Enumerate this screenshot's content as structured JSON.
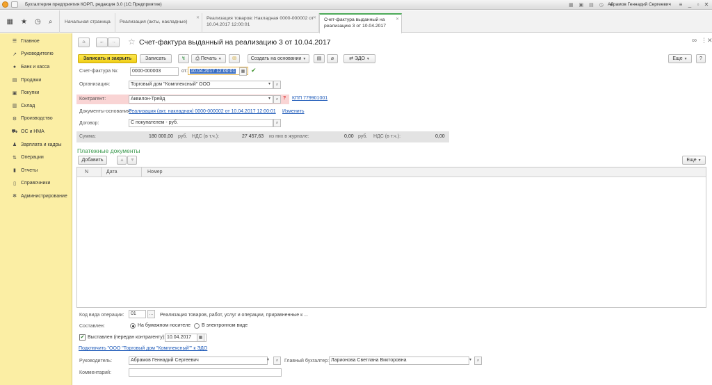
{
  "window": {
    "title": "Бухгалтерия предприятия КОРП, редакция 3.0  (1С:Предприятие)",
    "user": "Абрамов Геннадий Сергеевич",
    "icons": [
      "home-icon",
      "star-icon",
      "history-icon",
      "search-icon",
      "calc-icon",
      "calendar-icon",
      "print-icon",
      "bell-icon"
    ]
  },
  "tabs": [
    {
      "label": "Начальная страница"
    },
    {
      "label": "Реализация (акты, накладные)"
    },
    {
      "label": "Реализация товаров: Накладная 0000-000002 от 10.04.2017 12:00:01"
    },
    {
      "label": "Счет-фактура выданный на реализацию 3 от 10.04.2017"
    }
  ],
  "sidebar": {
    "items": [
      {
        "label": "Главное",
        "icon": "menu-icon"
      },
      {
        "label": "Руководителю",
        "icon": "trend-icon"
      },
      {
        "label": "Банк и касса",
        "icon": "bank-icon"
      },
      {
        "label": "Продажи",
        "icon": "sales-icon"
      },
      {
        "label": "Покупки",
        "icon": "cart-icon"
      },
      {
        "label": "Склад",
        "icon": "warehouse-icon"
      },
      {
        "label": "Производство",
        "icon": "factory-icon"
      },
      {
        "label": "ОС и НМА",
        "icon": "assets-icon"
      },
      {
        "label": "Зарплата и кадры",
        "icon": "people-icon"
      },
      {
        "label": "Операции",
        "icon": "operations-icon"
      },
      {
        "label": "Отчеты",
        "icon": "reports-icon"
      },
      {
        "label": "Справочники",
        "icon": "book-icon"
      },
      {
        "label": "Администрирование",
        "icon": "gear-icon"
      }
    ]
  },
  "doc": {
    "title": "Счет-фактура выданный на реализацию 3 от 10.04.2017"
  },
  "toolbar": {
    "save_close": "Записать и закрыть",
    "save": "Записать",
    "print": "Печать",
    "create_based": "Создать на основании",
    "edo": "ЭДО",
    "more": "Еще"
  },
  "form": {
    "invoice_label": "Счет-фактура №:",
    "invoice_number": "0000-000003",
    "from_label": "от:",
    "invoice_date": "10.04.2017 12:00:01",
    "org_label": "Организация:",
    "org_value": "Торговый дом \"Комплексный\" ООО",
    "contractor_label": "Контрагент:",
    "contractor_value": "Аквилон-Трейд",
    "question": "?",
    "kpp_link": "КПП 779901001",
    "base_docs_label": "Документы-основания:",
    "base_docs_link": "Реализация (акт, накладная) 0000-000002 от 10.04.2017 12:00:01",
    "change_link": "Изменить",
    "contract_label": "Договор:",
    "contract_value": "С покупателем - руб."
  },
  "summary": {
    "sum_label": "Сумма:",
    "sum_value": "180 000,00",
    "currency1": "руб.",
    "vat_label": "НДС (в т.ч.):",
    "vat_value": "27 457,63",
    "journal_label": "из них в журнале:",
    "journal_value": "0,00",
    "currency2": "руб.",
    "vat2_label": "НДС (в т.ч.):",
    "vat2_value": "0,00"
  },
  "payments": {
    "title": "Платежные документы",
    "add_button": "Добавить",
    "more": "Еще",
    "columns": [
      "N",
      "Дата",
      "Номер"
    ]
  },
  "bottom": {
    "op_code_label": "Код вида операции:",
    "op_code_value": "01",
    "op_code_desc": "Реализация товаров, работ, услуг и операции, приравненные к ...",
    "composed_label": "Составлен:",
    "paper_option": "На бумажном носителе",
    "electronic_option": "В электронном виде",
    "issued_label": "Выставлен (передан контрагенту):",
    "issued_date": "10.04.2017",
    "edo_link": "Подключить \"ООО \"Торговый дом \"Комплексный\"\" к ЭДО",
    "head_label": "Руководитель:",
    "head_value": "Абрамов Геннадий Сергеевич",
    "accountant_label": "Главный бухгалтер:",
    "accountant_value": "Ларионова Светлана Викторовна",
    "comment_label": "Комментарий:",
    "comment_value": ""
  }
}
